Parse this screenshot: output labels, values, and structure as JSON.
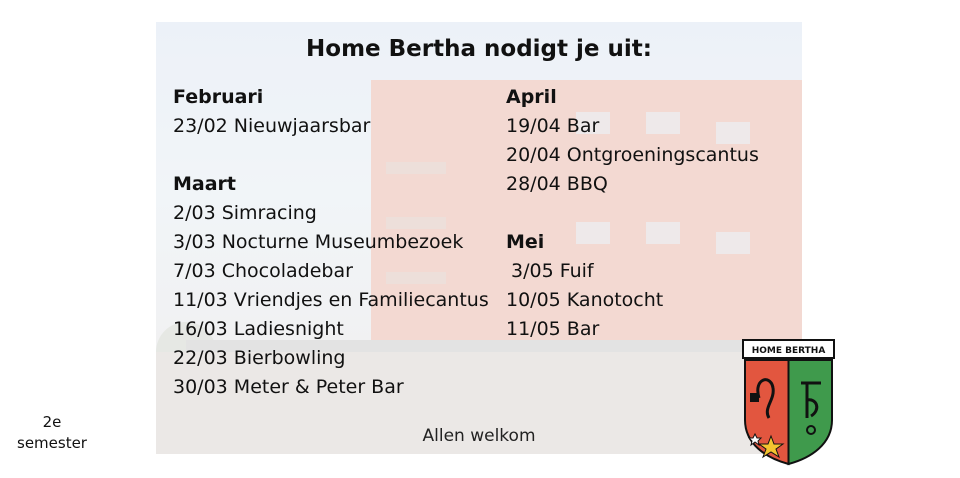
{
  "title": "Home Bertha nodigt je uit:",
  "left_column": {
    "months": [
      {
        "name": "Februari",
        "events": [
          "23/02 Nieuwjaarsbar"
        ]
      },
      {
        "name": "Maart",
        "events": [
          "2/03 Simracing",
          "3/03 Nocturne Museumbezoek",
          "7/03 Chocoladebar",
          "11/03 Vriendjes en Familiecantus",
          "16/03 Ladiesnight",
          "22/03 Bierbowling",
          "30/03 Meter & Peter Bar"
        ]
      }
    ]
  },
  "right_column": {
    "months": [
      {
        "name": "April",
        "events": [
          "19/04 Bar",
          "20/04 Ontgroeningscantus",
          "28/04 BBQ"
        ]
      },
      {
        "name": "Mei",
        "events": [
          "3/05 Fuif",
          "10/05 Kanotocht",
          "11/05 Bar"
        ]
      }
    ]
  },
  "footer": "Allen welkom",
  "side_label": {
    "line1": "2e",
    "line2": "semester"
  },
  "crest": {
    "banner": "HOME BERTHA",
    "left_color": "#e2563f",
    "right_color": "#3f9a4c"
  }
}
